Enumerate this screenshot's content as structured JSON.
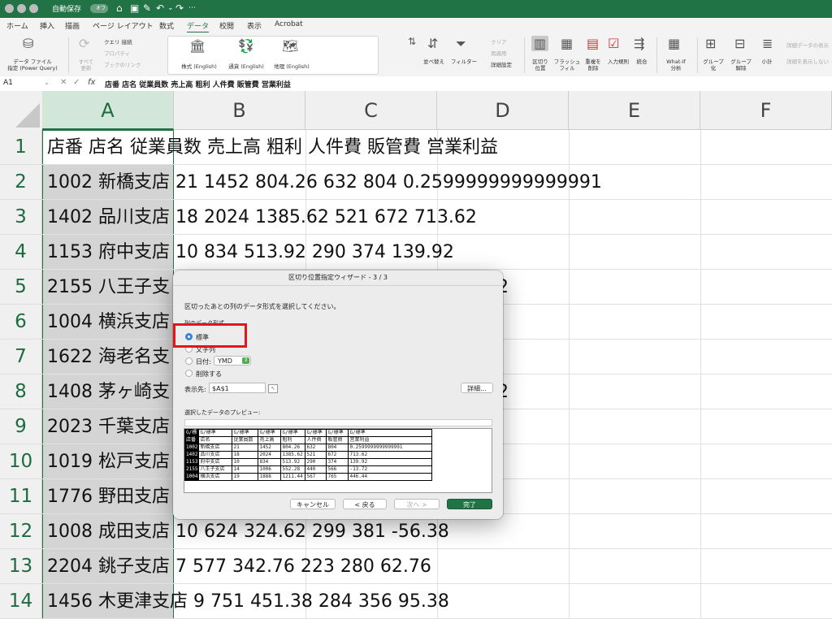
{
  "titlebar": {
    "autosave_label": "自動保存",
    "autosave_state": "オフ"
  },
  "ribbon_tabs": [
    "ホーム",
    "挿入",
    "描画",
    "ページ レイアウト",
    "数式",
    "データ",
    "校閲",
    "表示",
    "Acrobat"
  ],
  "active_tab": "データ",
  "ribbon": {
    "get_data": "データ ファイル\n指定 (Power Query)",
    "refresh_all": "すべて\n更新",
    "queries": "クエリ  接続",
    "properties": "プロパティ",
    "workbook_links": "ブックのリンク",
    "stocks": "株式 (English)",
    "currencies": "通貨 (English)",
    "geography": "地理 (English)",
    "sort": "並べ替え",
    "filter": "フィルター",
    "clear": "クリア",
    "reapply": "再適用",
    "advanced": "詳細設定",
    "text_to_columns": "区切り\n位置",
    "flash_fill": "フラッシュ\nフィル",
    "remove_duplicates": "重複を\n削除",
    "data_validation": "入力規則",
    "consolidate": "統合",
    "what_if": "What-If\n分析",
    "group": "グループ\n化",
    "ungroup": "グループ\n解除",
    "subtotal": "小計",
    "show_detail": "詳細データの表示",
    "hide_detail": "詳細を表示しない"
  },
  "formula_bar": {
    "name_box": "A1",
    "fx": "fx",
    "content": "店番 店名 従業員数 売上高 粗利 人件費 販管費 営業利益"
  },
  "columns": [
    "A",
    "B",
    "C",
    "D",
    "E",
    "F"
  ],
  "rows": [
    {
      "num": "1",
      "text": "店番 店名 従業員数 売上高 粗利 人件費 販管費 営業利益"
    },
    {
      "num": "2",
      "text": "1002 新橋支店 21 1452 804.26 632 804 0.2599999999999991"
    },
    {
      "num": "3",
      "text": "1402 品川支店 18 2024 1385.62 521 672 713.62"
    },
    {
      "num": "4",
      "text": "1153 府中支店 10 834 513.92 290 374 139.92"
    },
    {
      "num": "5",
      "text": "2155 八王子支",
      "tail": "2"
    },
    {
      "num": "6",
      "text": "1004 横浜支店"
    },
    {
      "num": "7",
      "text": "1622 海老名支"
    },
    {
      "num": "8",
      "text": "1408 茅ヶ崎支",
      "tail": "2"
    },
    {
      "num": "9",
      "text": "2023 千葉支店"
    },
    {
      "num": "10",
      "text": "1019 松戸支店"
    },
    {
      "num": "11",
      "text": "1776 野田支店"
    },
    {
      "num": "12",
      "text": "1008 成田支店 10 624 324.62 299 381 -56.38"
    },
    {
      "num": "13",
      "text": "2204 銚子支店 7 577 342.76 223 280 62.76"
    },
    {
      "num": "14",
      "text": "1456 木更津支店 9 751 451.38 284 356 95.38"
    }
  ],
  "dialog": {
    "title": "区切り位置指定ウィザード - 3 / 3",
    "instruction": "区切ったあとの列のデータ形式を選択してください。",
    "group_label": "列のデータ形式",
    "opt_standard": "標準",
    "opt_text": "文字列",
    "opt_date": "日付:",
    "date_format": "YMD",
    "opt_skip": "削除する",
    "dest_label": "表示先:",
    "dest_value": "$A$1",
    "advanced_button": "詳細...",
    "preview_label": "選択したデータのプレビュー:",
    "preview_header": [
      "G/標",
      "G/標準",
      "G/標準",
      "G/標準",
      "G/標準",
      "G/標準",
      "G/標準",
      "G/標準"
    ],
    "preview_rows": [
      [
        "店番",
        "店名",
        "従業員数",
        "売上高",
        "粗利",
        "人件費",
        "販管費",
        "営業利益"
      ],
      [
        "1002",
        "新橋支店",
        "21",
        "1452",
        "804.26",
        "632",
        "804",
        "0.2599999999999991"
      ],
      [
        "1402",
        "品川支店",
        "18",
        "2024",
        "1385.62",
        "521",
        "672",
        "713.62"
      ],
      [
        "1153",
        "府中支店",
        "10",
        "834",
        "513.92",
        "290",
        "374",
        "139.92"
      ],
      [
        "2155",
        "八王子支店",
        "14",
        "1006",
        "552.28",
        "440",
        "566",
        "-13.72"
      ],
      [
        "1004",
        "横浜支店",
        "19",
        "1888",
        "1211.44",
        "567",
        "765",
        "446.44"
      ]
    ],
    "cancel": "キャンセル",
    "back": "< 戻る",
    "next": "次へ >",
    "finish": "完了"
  }
}
